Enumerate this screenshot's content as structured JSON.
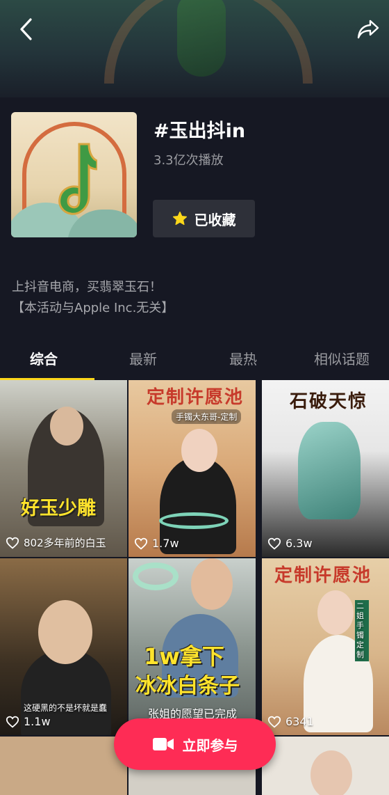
{
  "header": {
    "back_icon": "chevron-left-icon",
    "share_icon": "share-arrow-icon"
  },
  "topic": {
    "title": "#玉出抖in",
    "plays": "3.3亿次播放",
    "favorite_label": "已收藏",
    "description_lines": [
      "上抖音电商，买翡翠玉石！",
      "【本活动与Apple Inc.无关】"
    ]
  },
  "tabs": [
    {
      "label": "综合",
      "active": true
    },
    {
      "label": "最新",
      "active": false
    },
    {
      "label": "最热",
      "active": false
    },
    {
      "label": "相似话题",
      "active": false
    }
  ],
  "videos": [
    {
      "overlay": "好玉少雕",
      "subtitle": "802多年前的白玉",
      "likes": ""
    },
    {
      "overlay": "定制许愿池",
      "subtitle": "手镯大东哥-定制",
      "likes": "1.7w"
    },
    {
      "overlay": "石破天惊",
      "subtitle": "",
      "likes": "6.3w"
    },
    {
      "overlay": "",
      "subtitle": "这硬黑的不是坏就是蠢",
      "likes": "1.1w"
    },
    {
      "overlay": "1w拿下",
      "overlay2": "冰冰白条子",
      "subtitle": "张姐的愿望已完成",
      "likes": ""
    },
    {
      "overlay": "定制许愿池",
      "subtitle": "二姐手镯定制",
      "likes": "6341"
    }
  ],
  "cta": {
    "label": "立即参与",
    "icon": "video-camera-icon",
    "color": "#fe2c55"
  },
  "colors": {
    "accent": "#fcd71b",
    "background": "#161823"
  }
}
